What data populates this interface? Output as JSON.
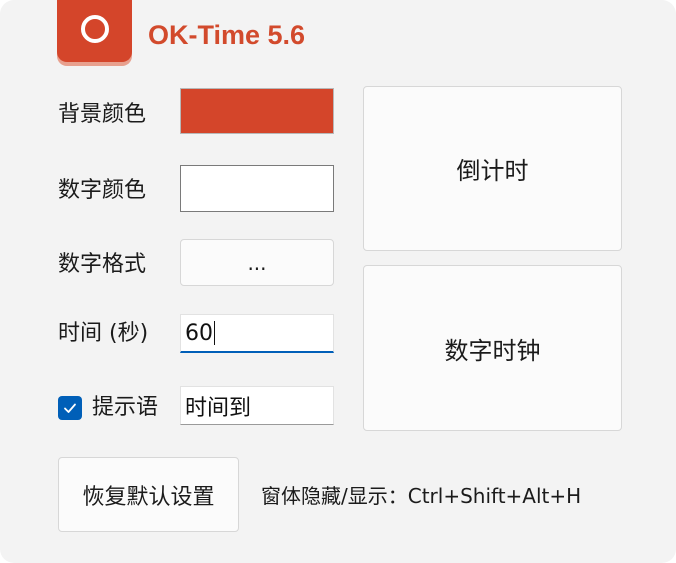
{
  "app": {
    "title": "OK-Time 5.6",
    "brand_color": "#d24a2c",
    "icon": "ring-icon"
  },
  "settings": {
    "background_color_label": "背景颜色",
    "background_color_value": "#d4452a",
    "digit_color_label": "数字颜色",
    "digit_color_value": "#ffffff",
    "digit_format_label": "数字格式",
    "digit_format_button": "...",
    "time_label": "时间 (秒)",
    "time_value": "60",
    "prompt_checkbox_checked": true,
    "prompt_label": "提示语",
    "prompt_value": "时间到"
  },
  "actions": {
    "countdown_label": "倒计时",
    "digital_clock_label": "数字时钟",
    "reset_label": "恢复默认设置"
  },
  "hotkey_text": "窗体隐藏/显示：Ctrl+Shift+Alt+H",
  "colors": {
    "accent_blue": "#005fb8",
    "window_bg": "#f3f3f3"
  }
}
